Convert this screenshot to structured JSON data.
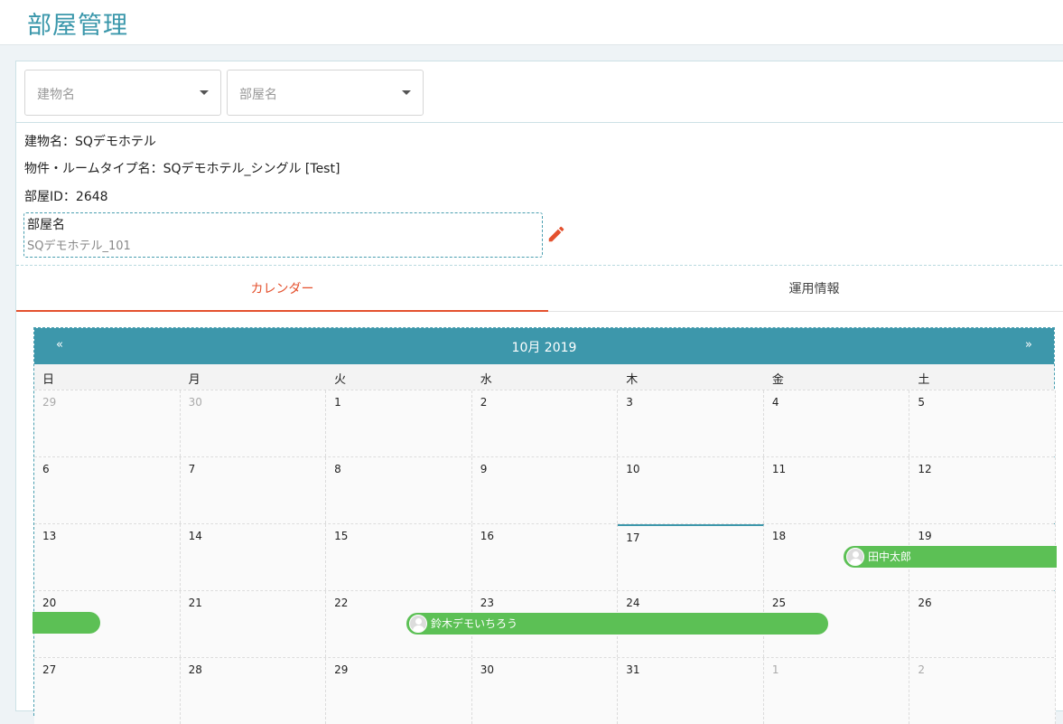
{
  "page": {
    "title": "部屋管理"
  },
  "filters": {
    "building_placeholder": "建物名",
    "room_placeholder": "部屋名"
  },
  "info": {
    "building_line": "建物名：SQデモホテル",
    "property_line": "物件・ルームタイプ名：SQデモホテル_シングル [Test]",
    "room_id_line": "部屋ID：2648",
    "room_name_label": "部屋名",
    "room_name_value": "SQデモホテル_101",
    "edit_icon": "pencil-icon"
  },
  "tabs": [
    {
      "label": "カレンダー",
      "active": true
    },
    {
      "label": "運用情報",
      "active": false
    }
  ],
  "calendar": {
    "month_label": "10月 2019",
    "prev": "«",
    "next": "»",
    "weekdays": [
      "日",
      "月",
      "火",
      "水",
      "木",
      "金",
      "土"
    ],
    "weeks": [
      [
        {
          "d": "29",
          "m": true
        },
        {
          "d": "30",
          "m": true
        },
        {
          "d": "1"
        },
        {
          "d": "2"
        },
        {
          "d": "3"
        },
        {
          "d": "4"
        },
        {
          "d": "5"
        }
      ],
      [
        {
          "d": "6"
        },
        {
          "d": "7"
        },
        {
          "d": "8"
        },
        {
          "d": "9"
        },
        {
          "d": "10"
        },
        {
          "d": "11"
        },
        {
          "d": "12"
        }
      ],
      [
        {
          "d": "13"
        },
        {
          "d": "14"
        },
        {
          "d": "15"
        },
        {
          "d": "16"
        },
        {
          "d": "17",
          "today": true
        },
        {
          "d": "18"
        },
        {
          "d": "19"
        }
      ],
      [
        {
          "d": "20"
        },
        {
          "d": "21"
        },
        {
          "d": "22"
        },
        {
          "d": "23"
        },
        {
          "d": "24"
        },
        {
          "d": "25"
        },
        {
          "d": "26"
        }
      ],
      [
        {
          "d": "27"
        },
        {
          "d": "28"
        },
        {
          "d": "29"
        },
        {
          "d": "30"
        },
        {
          "d": "31"
        },
        {
          "d": "1",
          "m": true
        },
        {
          "d": "2",
          "m": true
        }
      ]
    ],
    "events": [
      {
        "name": "田中太郎"
      },
      {
        "name": ""
      },
      {
        "name": "鈴木デモいちろう"
      }
    ],
    "colors": {
      "header": "#3d97ab",
      "event": "#5cc055",
      "accent": "#e4512e"
    }
  }
}
